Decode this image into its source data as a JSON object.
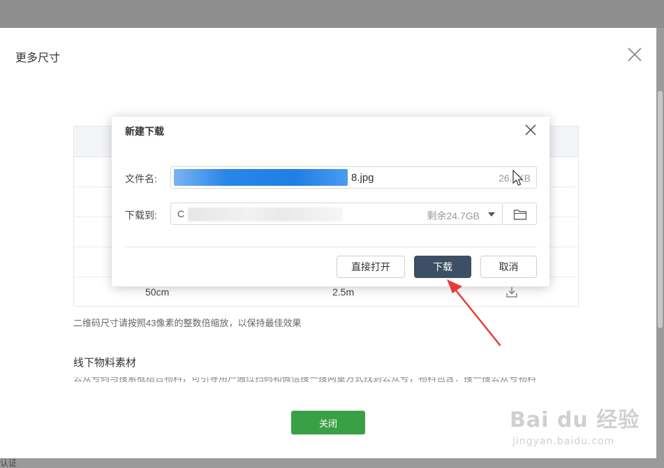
{
  "outer_dialog": {
    "title": "更多尺寸",
    "table_rows": [
      {
        "col1": "",
        "col2": ""
      },
      {
        "col1": "",
        "col2": ""
      },
      {
        "col1": "",
        "col2": ""
      },
      {
        "col1": "",
        "col2": ""
      },
      {
        "col1": "50cm",
        "col2": "2.5m"
      }
    ],
    "tip": "二维码尺寸请按照43像素的整数倍缩放，以保持最佳效果",
    "section_title": "线下物料素材",
    "section_desc": "公众号码与搜索框结合物料，可引导用户通过扫码和微信搜一搜两重方式找到公众号，物料包含：搜一搜公众号物料",
    "close_label": "关闭"
  },
  "download_dialog": {
    "title": "新建下载",
    "filename_label": "文件名:",
    "filename_visible_suffix": "8.jpg",
    "file_size": "26.5KB",
    "path_label": "下载到:",
    "path_prefix": "C",
    "free_space": "剩余24.7GB",
    "buttons": {
      "open": "直接打开",
      "download": "下载",
      "cancel": "取消"
    }
  },
  "bottom_text": "认证",
  "watermark": {
    "logo": "Bai du 经验",
    "url": "jingyan.baidu.com"
  },
  "colors": {
    "primary_dark": "#3d4f64",
    "close_green": "#3aa046",
    "arrow_red": "#e83a3a",
    "selection_blue": "#1f7fe6"
  }
}
